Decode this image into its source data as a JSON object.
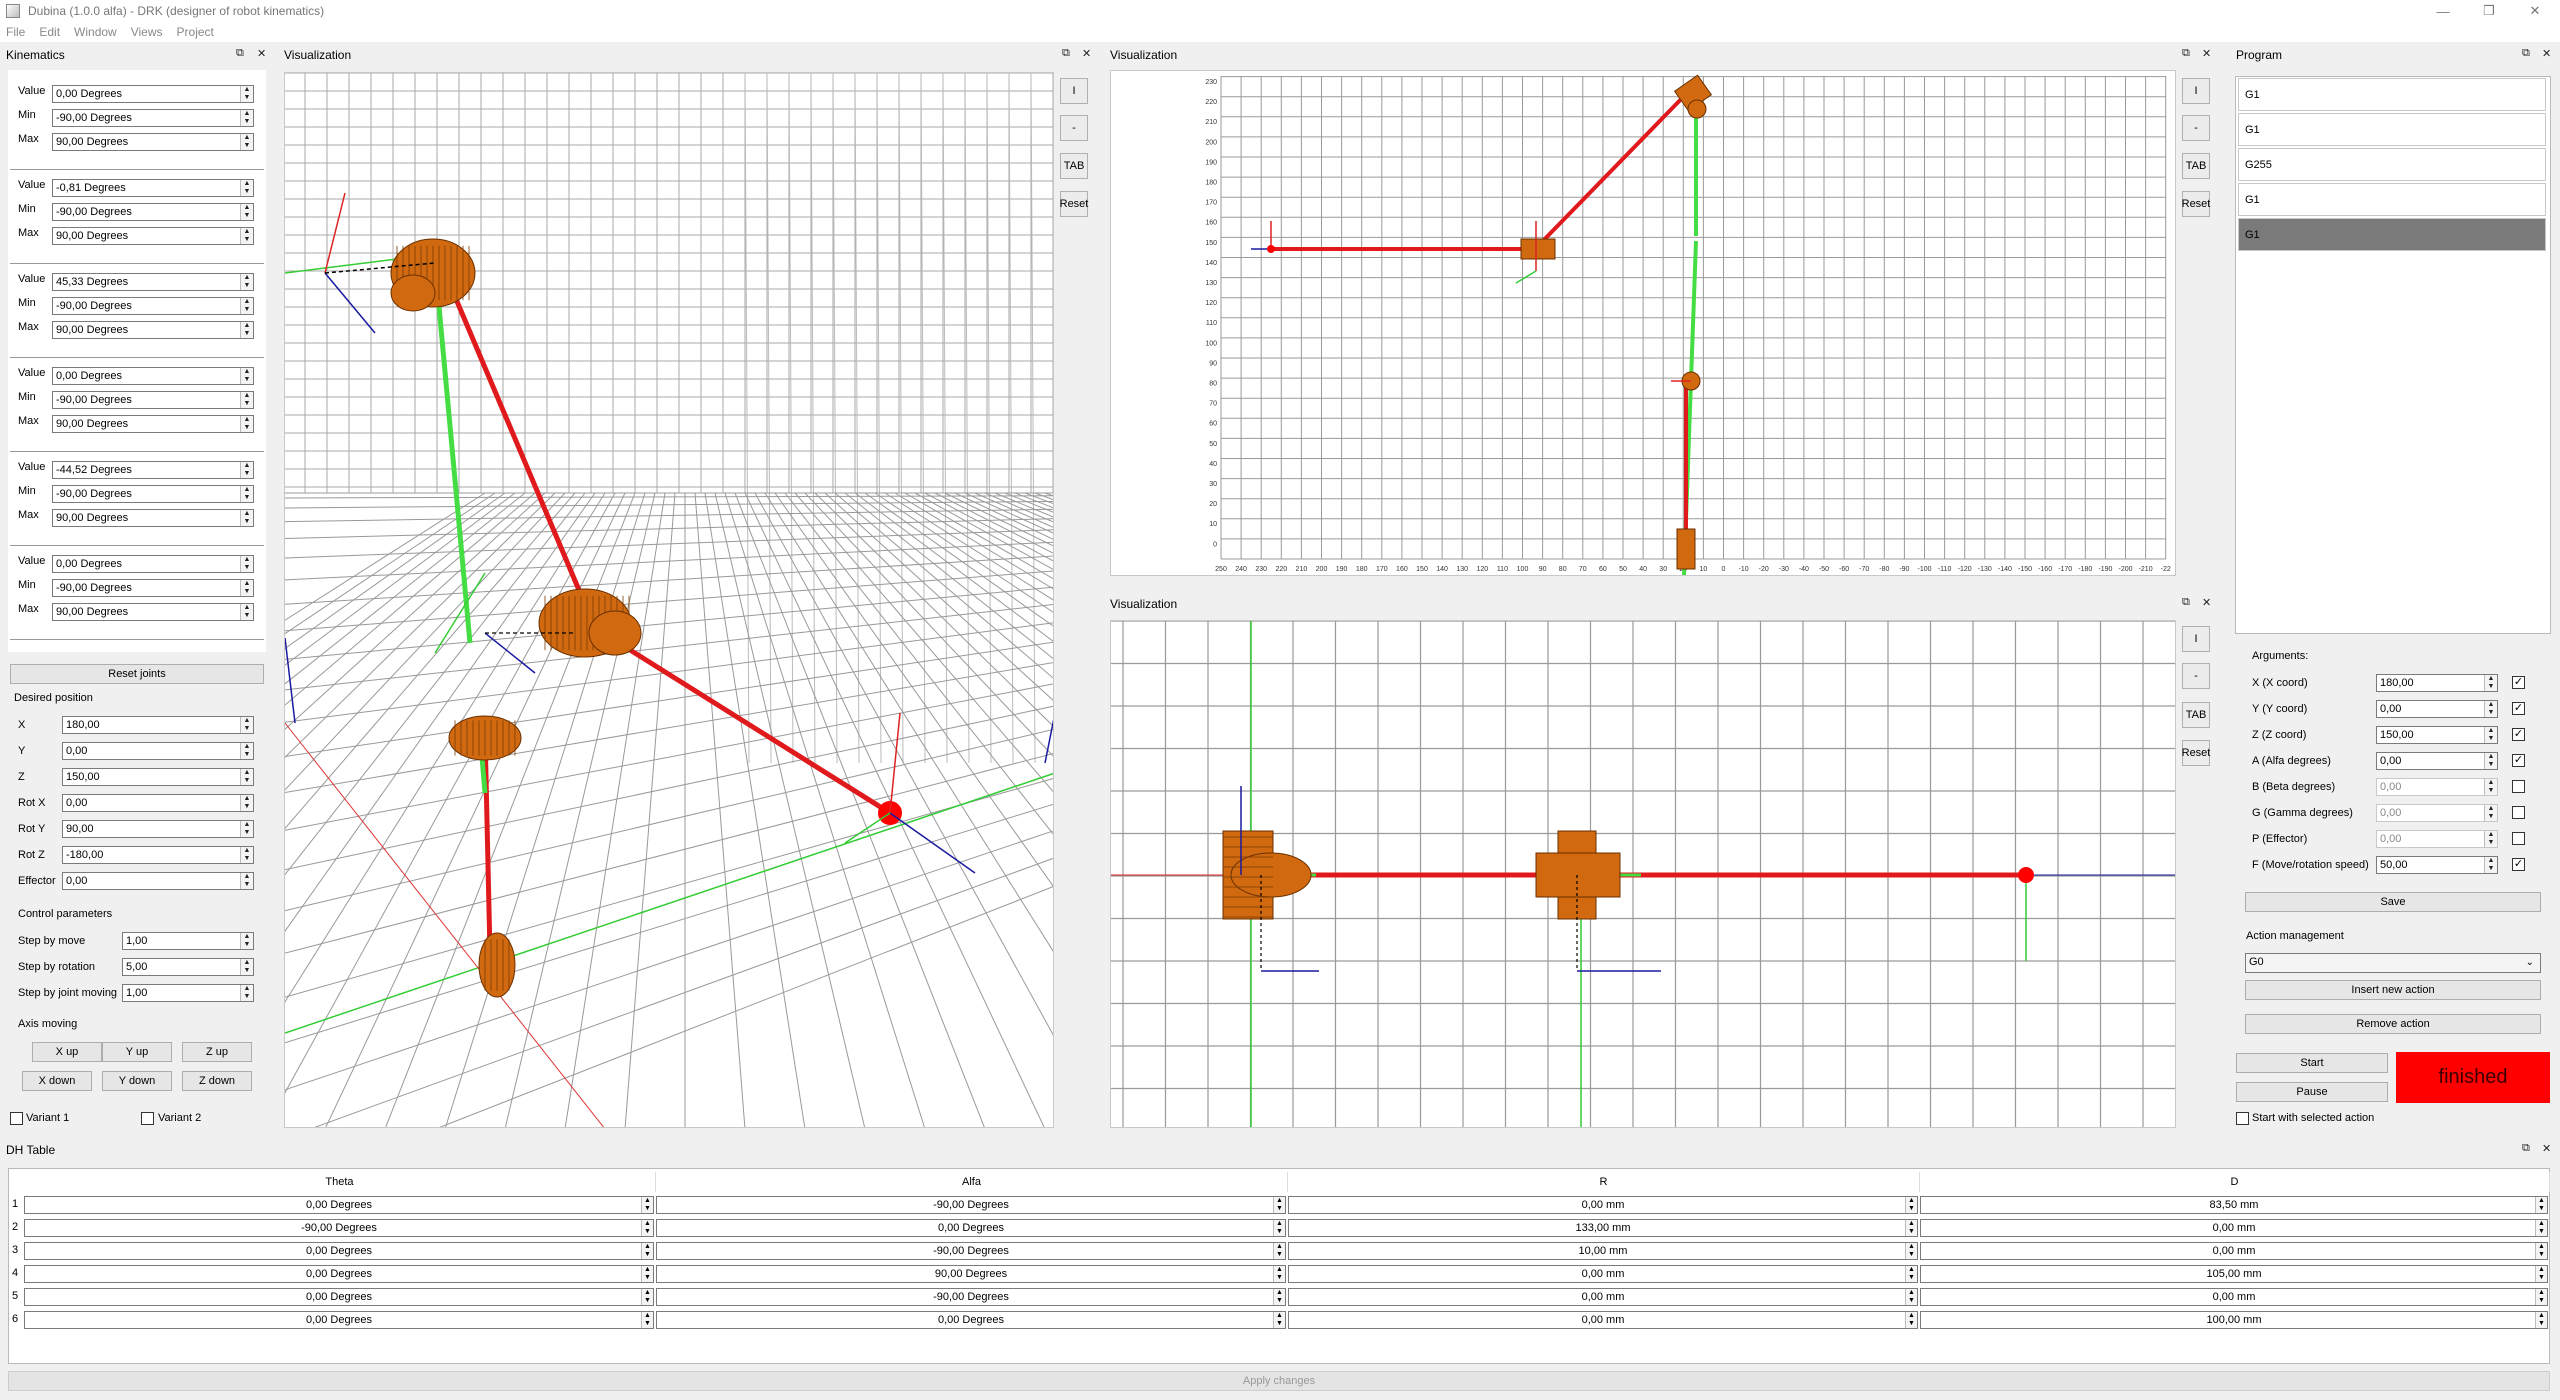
{
  "window": {
    "title": "Dubina (1.0.0 alfa) - DRK (designer of robot kinematics)",
    "min_glyph": "—",
    "max_glyph": "❐",
    "close_glyph": "✕"
  },
  "menu": [
    "File",
    "Edit",
    "Window",
    "Views",
    "Project"
  ],
  "docks": {
    "kinematics": "Kinematics",
    "vis_3d": "Visualization",
    "vis_top": "Visualization",
    "vis_bottom": "Visualization",
    "program": "Program",
    "dh": "DH Table",
    "float_glyph": "⧉",
    "close_glyph": "✕"
  },
  "joints": [
    {
      "value_label": "Value",
      "min_label": "Min",
      "max_label": "Max",
      "value": "0,00 Degrees",
      "min": "-90,00 Degrees",
      "max": "90,00 Degrees"
    },
    {
      "value_label": "Value",
      "min_label": "Min",
      "max_label": "Max",
      "value": "-0,81 Degrees",
      "min": "-90,00 Degrees",
      "max": "90,00 Degrees"
    },
    {
      "value_label": "Value",
      "min_label": "Min",
      "max_label": "Max",
      "value": "45,33 Degrees",
      "min": "-90,00 Degrees",
      "max": "90,00 Degrees"
    },
    {
      "value_label": "Value",
      "min_label": "Min",
      "max_label": "Max",
      "value": "0,00 Degrees",
      "min": "-90,00 Degrees",
      "max": "90,00 Degrees"
    },
    {
      "value_label": "Value",
      "min_label": "Min",
      "max_label": "Max",
      "value": "-44,52 Degrees",
      "min": "-90,00 Degrees",
      "max": "90,00 Degrees"
    },
    {
      "value_label": "Value",
      "min_label": "Min",
      "max_label": "Max",
      "value": "0,00 Degrees",
      "min": "-90,00 Degrees",
      "max": "90,00 Degrees"
    }
  ],
  "reset_joints": "Reset joints",
  "desired": {
    "title": "Desired position",
    "fields": [
      {
        "label": "X",
        "value": "180,00"
      },
      {
        "label": "Y",
        "value": "0,00"
      },
      {
        "label": "Z",
        "value": "150,00"
      },
      {
        "label": "Rot X",
        "value": "0,00"
      },
      {
        "label": "Rot Y",
        "value": "90,00"
      },
      {
        "label": "Rot Z",
        "value": "-180,00"
      },
      {
        "label": "Effector",
        "value": "0,00"
      }
    ]
  },
  "control": {
    "title": "Control parameters",
    "fields": [
      {
        "label": "Step by move",
        "value": "1,00"
      },
      {
        "label": "Step by rotation",
        "value": "5,00"
      },
      {
        "label": "Step by joint moving",
        "value": "1,00"
      }
    ]
  },
  "axis": {
    "title": "Axis moving",
    "buttons": [
      "X up",
      "Y up",
      "Z up",
      "X down",
      "Y down",
      "Z down"
    ]
  },
  "variants": [
    "Variant 1",
    "Variant 2"
  ],
  "vis_buttons": [
    "I",
    "-",
    "TAB",
    "Reset"
  ],
  "program": {
    "items": [
      "G1",
      "G1",
      "G255",
      "G1",
      "G1"
    ],
    "selected_index": 4
  },
  "arguments": {
    "title": "Arguments:",
    "rows": [
      {
        "label": "X (X coord)",
        "value": "180,00",
        "checked": true,
        "enabled": true
      },
      {
        "label": "Y (Y coord)",
        "value": "0,00",
        "checked": true,
        "enabled": true
      },
      {
        "label": "Z (Z coord)",
        "value": "150,00",
        "checked": true,
        "enabled": true
      },
      {
        "label": "A (Alfa degrees)",
        "value": "0,00",
        "checked": true,
        "enabled": true
      },
      {
        "label": "B (Beta degrees)",
        "value": "0,00",
        "checked": false,
        "enabled": false
      },
      {
        "label": "G (Gamma degrees)",
        "value": "0,00",
        "checked": false,
        "enabled": false
      },
      {
        "label": "P (Effector)",
        "value": "0,00",
        "checked": false,
        "enabled": false
      },
      {
        "label": "F (Move/rotation speed)",
        "value": "50,00",
        "checked": true,
        "enabled": true
      }
    ],
    "save": "Save"
  },
  "actions": {
    "title": "Action management",
    "selected": "G0",
    "insert": "Insert new action",
    "remove": "Remove action"
  },
  "run": {
    "start": "Start",
    "pause": "Pause",
    "status": "finished",
    "status_color": "#ff0000",
    "start_selected": "Start with selected action"
  },
  "dh_table": {
    "headers": [
      "Theta",
      "Alfa",
      "R",
      "D"
    ],
    "rows": [
      [
        "0,00 Degrees",
        "-90,00 Degrees",
        "0,00 mm",
        "83,50 mm"
      ],
      [
        "-90,00 Degrees",
        "0,00 Degrees",
        "133,00 mm",
        "0,00 mm"
      ],
      [
        "0,00 Degrees",
        "-90,00 Degrees",
        "10,00 mm",
        "0,00 mm"
      ],
      [
        "0,00 Degrees",
        "90,00 Degrees",
        "0,00 mm",
        "105,00 mm"
      ],
      [
        "0,00 Degrees",
        "-90,00 Degrees",
        "0,00 mm",
        "0,00 mm"
      ],
      [
        "0,00 Degrees",
        "0,00 Degrees",
        "0,00 mm",
        "100,00 mm"
      ]
    ],
    "apply": "Apply changes"
  },
  "top_view_axis": {
    "x_ticks": [
      "250",
      "240",
      "230",
      "220",
      "210",
      "200",
      "190",
      "180",
      "170",
      "160",
      "150",
      "140",
      "130",
      "120",
      "110",
      "100",
      "90",
      "80",
      "70",
      "60",
      "50",
      "40",
      "30",
      "20",
      "10",
      "0",
      "-10",
      "-20",
      "-30",
      "-40",
      "-50",
      "-60",
      "-70",
      "-80",
      "-90",
      "-100",
      "-110",
      "-120",
      "-130",
      "-140",
      "-150",
      "-160",
      "-170",
      "-180",
      "-190",
      "-200",
      "-210",
      "-22"
    ],
    "y_ticks": [
      "230",
      "220",
      "210",
      "200",
      "190",
      "180",
      "170",
      "160",
      "150",
      "140",
      "130",
      "120",
      "110",
      "100",
      "90",
      "80",
      "70",
      "60",
      "50",
      "40",
      "30",
      "20",
      "10",
      "0"
    ]
  },
  "colors": {
    "link_red": "#e0191c",
    "link_green": "#44dd44",
    "joint_orange": "#d0690f",
    "axis_blue": "#1a1aa0",
    "grid": "#9a9a9a"
  }
}
